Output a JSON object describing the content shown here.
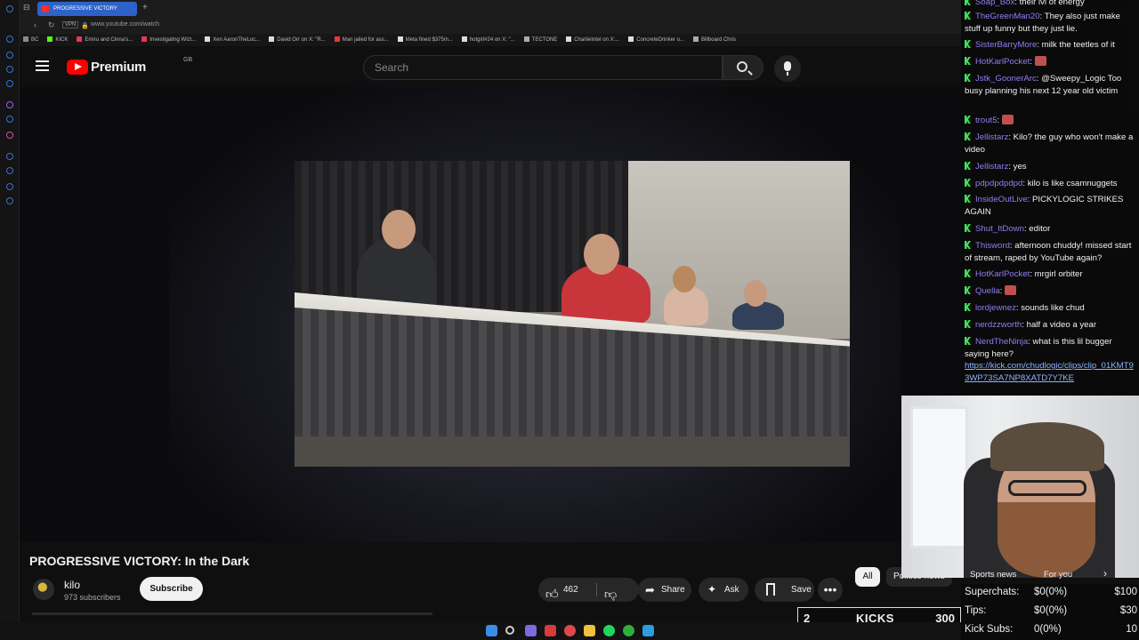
{
  "browser": {
    "tab_title": "PROGRESSIVE VICTORY",
    "url": "www.youtube.com/watch",
    "vpn_label": "VPN",
    "bookmarks": [
      "BC",
      "KICK",
      "Emiru and Cinna's...",
      "Investigating Wizt...",
      "Xen AaronTheLoc...",
      "David Orr on X: \"R...",
      "Man jailed for ass...",
      "Meta fined $375m...",
      "hotgirl#24 on X: \"...",
      "TECTONE",
      "CharlieIntel on X:...",
      "ConcreteDrinker o...",
      "Billboard Chris"
    ]
  },
  "youtube": {
    "logo_text": "Premium",
    "region": "GB",
    "search_placeholder": "Search"
  },
  "video": {
    "title": "PROGRESSIVE VICTORY: In the Dark",
    "channel": "kilo",
    "subscribers": "973 subscribers",
    "subscribe_label": "Subscribe",
    "likes": "462",
    "share_label": "Share",
    "ask_label": "Ask",
    "save_label": "Save",
    "more_label": "•••"
  },
  "chips": {
    "all": "All",
    "politics": "Politics news",
    "sports": "Sports news",
    "for_you": "For you"
  },
  "chat": [
    {
      "user": "Soap_Box",
      "text": "their lvl of energy"
    },
    {
      "user": "TheGreenMan20",
      "text": "They also just make stuff up funny but they just lie."
    },
    {
      "user": "SisterBarryMore",
      "text": "milk the teetles of it"
    },
    {
      "user": "HotKarlPocket",
      "text": ""
    },
    {
      "user": "Jstk_GoonerArc",
      "text": "@Sweepy_Logic Too busy planning his next 12 year old victim"
    },
    {
      "user": "trout5",
      "text": ""
    },
    {
      "user": "Jellistarz",
      "text": "Kilo? the guy who won't make a video"
    },
    {
      "user": "Jellistarz",
      "text": "yes"
    },
    {
      "user": "pdpdpdpdpd",
      "text": "kilo is like csamnuggets"
    },
    {
      "user": "InsideOutLive",
      "text": "PICKYLOGIC STRIKES AGAIN"
    },
    {
      "user": "Shut_ItDown",
      "text": "editor"
    },
    {
      "user": "Thisword",
      "text": "afternoon chuddy! missed start of stream, raped by YouTube again?"
    },
    {
      "user": "HotKarlPocket",
      "text": "mrgirl orbiter"
    },
    {
      "user": "Quella",
      "text": ""
    },
    {
      "user": "lordjewnez",
      "text": "sounds like chud"
    },
    {
      "user": "nerdzzworth",
      "text": "half a video a year"
    },
    {
      "user": "NerdTheNinja",
      "text": "what is this lil bugger saying here?"
    }
  ],
  "chat_link": "https://kick.com/chudlogic/clips/clip_01KMT93WP73SA7NP8XATD7Y7KE",
  "stats": {
    "superchats": {
      "label": "Superchats:",
      "value": "$0(0%)",
      "goal": "$100"
    },
    "tips": {
      "label": "Tips:",
      "value": "$0(0%)",
      "goal": "$30"
    },
    "kick_subs": {
      "label": "Kick Subs:",
      "value": "0(0%)",
      "goal": "10"
    }
  },
  "kicks": {
    "count": "2",
    "label": "KICKS",
    "total": "300"
  }
}
